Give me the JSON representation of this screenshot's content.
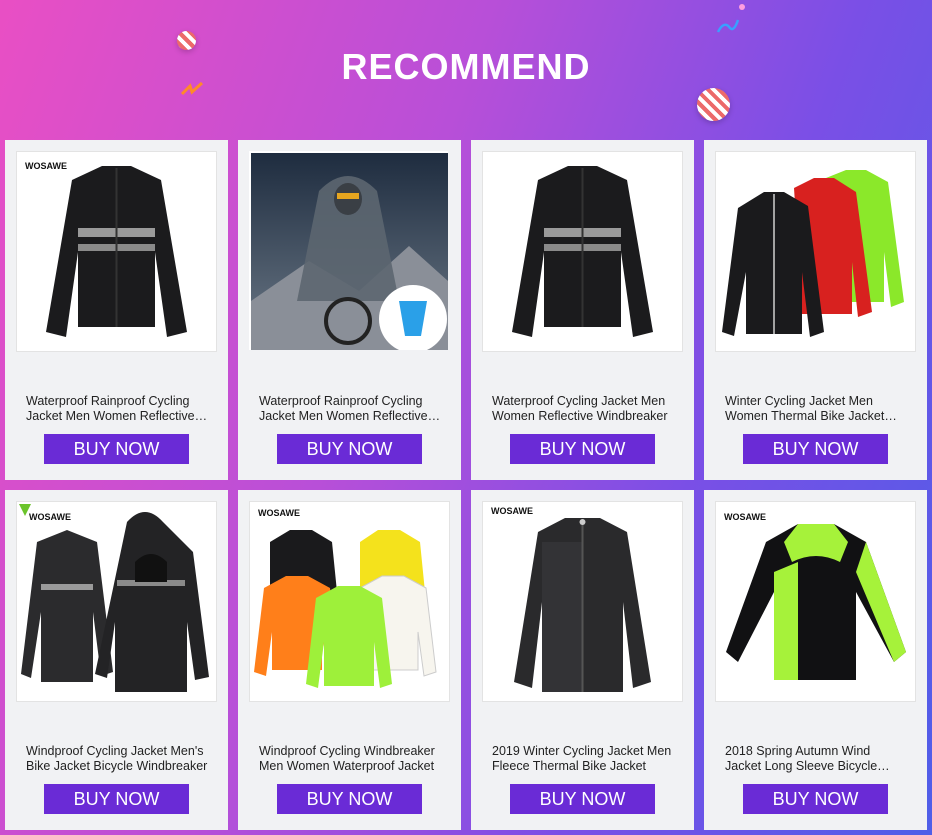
{
  "section_title": "RECOMMEND",
  "brand_logo": "WOSAWE",
  "products": [
    {
      "title": "Waterproof Rainproof Cycling Jacket Men Women Reflective Windbreaker",
      "button": "BUY NOW",
      "icon": "black-jacket-icon"
    },
    {
      "title": "Waterproof Rainproof Cycling Jacket Men Women Reflective Raincoat",
      "button": "BUY NOW",
      "icon": "raincoat-icon"
    },
    {
      "title": "Waterproof Cycling Jacket Men Women Reflective Windbreaker",
      "button": "BUY NOW",
      "icon": "black-jacket-icon"
    },
    {
      "title": "Winter Cycling Jacket Men Women Thermal Bike Jacket Fleece",
      "button": "BUY NOW",
      "icon": "three-jackets-icon"
    },
    {
      "title": "Windproof Cycling Jacket Men's Bike Jacket Bicycle Windbreaker",
      "button": "BUY NOW",
      "icon": "hooded-jackets-icon"
    },
    {
      "title": "Windproof Cycling Windbreaker Men Women Waterproof Jacket",
      "button": "BUY NOW",
      "icon": "color-jackets-icon"
    },
    {
      "title": "2019 Winter Cycling Jacket Men Fleece Thermal Bike Jacket",
      "button": "BUY NOW",
      "icon": "gray-jacket-icon"
    },
    {
      "title": "2018 Spring Autumn Wind Jacket Long Sleeve Bicycle Jersey",
      "button": "BUY NOW",
      "icon": "green-black-jacket-icon"
    }
  ],
  "colors": {
    "button": "#6a2bd6",
    "card": "#f1f2f4",
    "accent_green": "#a6f23a"
  }
}
